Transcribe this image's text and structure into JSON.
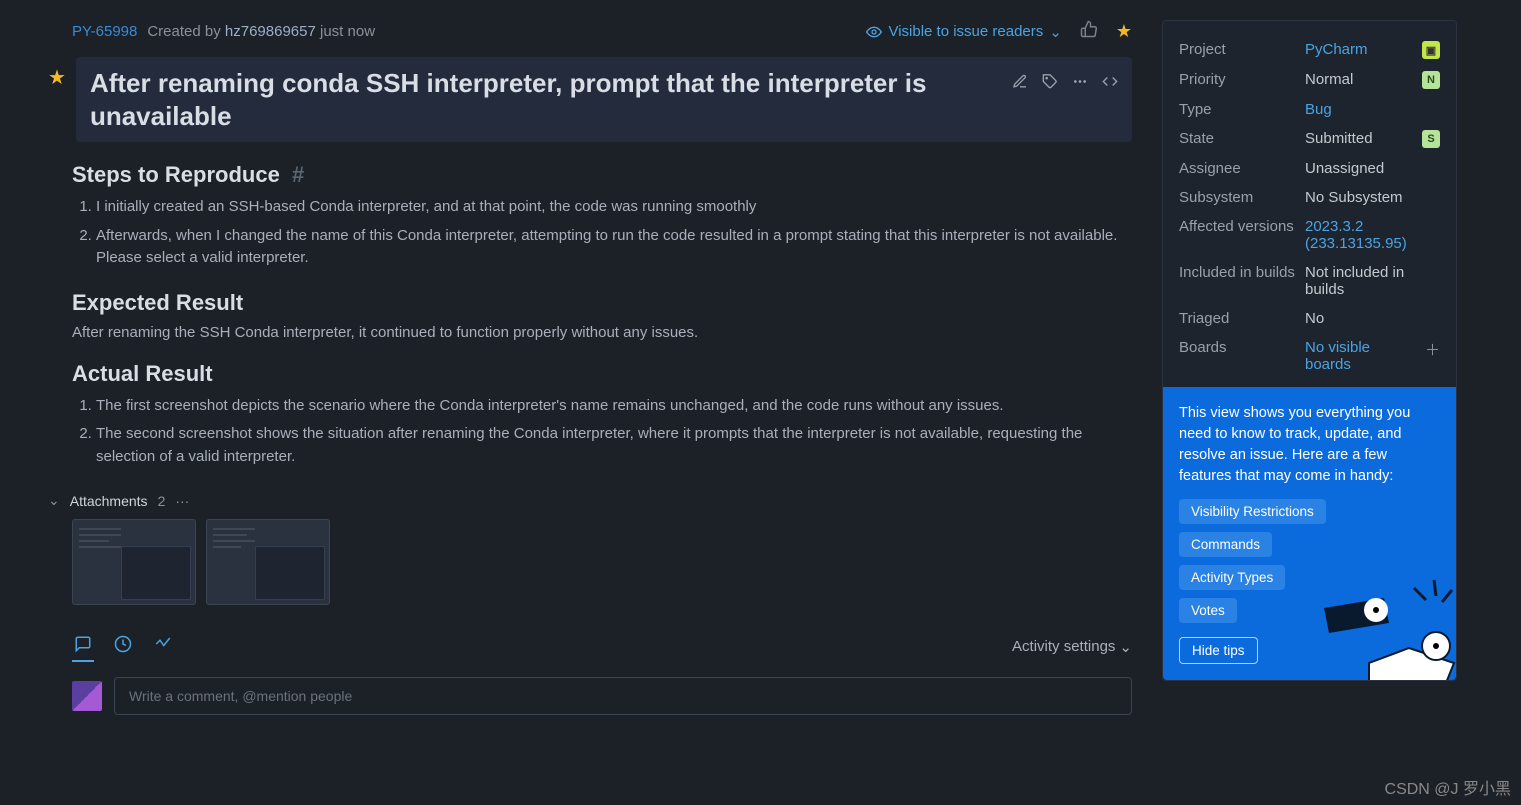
{
  "header": {
    "issue_id": "PY-65998",
    "created_by_prefix": "Created by",
    "author": "hz769869657",
    "created_ago": "just now",
    "visibility": "Visible to issue readers"
  },
  "title": "After renaming conda SSH interpreter, prompt that the interpreter is unavailable",
  "sections": {
    "steps_heading": "Steps to Reproduce",
    "steps": [
      "I initially created an SSH-based Conda interpreter, and at that point, the code was running smoothly",
      "Afterwards, when I changed the name of this Conda interpreter, attempting to run the code resulted in a prompt stating that this interpreter is not available. Please select a valid interpreter."
    ],
    "expected_heading": "Expected Result",
    "expected_body": "After renaming the SSH Conda interpreter, it continued to function properly without any issues.",
    "actual_heading": "Actual Result",
    "actual": [
      "The first screenshot depicts the scenario where the Conda interpreter's name remains unchanged, and the code runs without any issues.",
      "The second screenshot shows the situation after renaming the Conda interpreter, where it prompts that the interpreter is not available, requesting the selection of a valid interpreter."
    ]
  },
  "attachments": {
    "label": "Attachments",
    "count": "2"
  },
  "activity": {
    "settings_label": "Activity settings",
    "comment_placeholder": "Write a comment, @mention people"
  },
  "fields": {
    "project": {
      "label": "Project",
      "value": "PyCharm"
    },
    "priority": {
      "label": "Priority",
      "value": "Normal",
      "badge": "N"
    },
    "type": {
      "label": "Type",
      "value": "Bug"
    },
    "state": {
      "label": "State",
      "value": "Submitted",
      "badge": "S"
    },
    "assignee": {
      "label": "Assignee",
      "value": "Unassigned"
    },
    "subsystem": {
      "label": "Subsystem",
      "value": "No Subsystem"
    },
    "affected": {
      "label": "Affected versions",
      "value": "2023.3.2 (233.13135.95)"
    },
    "included": {
      "label": "Included in builds",
      "value": "Not included in builds"
    },
    "triaged": {
      "label": "Triaged",
      "value": "No"
    },
    "boards": {
      "label": "Boards",
      "value": "No visible boards"
    }
  },
  "tips": {
    "body": "This view shows you everything you need to know to track, update, and resolve an issue. Here are a few features that may come in handy:",
    "chips": [
      "Visibility Restrictions",
      "Commands",
      "Activity Types",
      "Votes"
    ],
    "hide": "Hide tips"
  },
  "watermark": "CSDN @J 罗小黑"
}
